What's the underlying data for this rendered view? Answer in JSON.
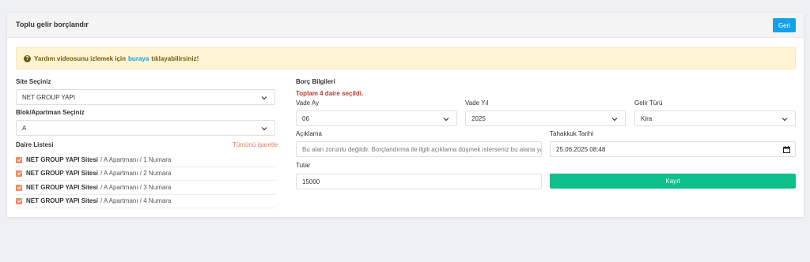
{
  "header": {
    "title": "Toplu gelir borçlandır",
    "back_label": "Geri"
  },
  "alert": {
    "prefix": "Yardım videosunu izlemek için",
    "link": "buraya",
    "suffix": "tıklayabilirsiniz!"
  },
  "left": {
    "site_label": "Site Seçiniz",
    "site_value": "NET GROUP YAPI",
    "block_label": "Blok/Apartman Seçiniz",
    "block_value": "A",
    "units_label": "Daire Listesi",
    "select_all": "Tümünü işaretle",
    "units": [
      {
        "site": "NET GROUP YAPI Sitesi",
        "path": "/ A Apartmanı / 1 Numara"
      },
      {
        "site": "NET GROUP YAPI Sitesi",
        "path": "/ A Apartmanı / 2 Numara"
      },
      {
        "site": "NET GROUP YAPI Sitesi",
        "path": "/ A Apartmanı / 3 Numara"
      },
      {
        "site": "NET GROUP YAPI Sitesi",
        "path": "/ A Apartmanı / 4 Numara"
      }
    ]
  },
  "right": {
    "section_title": "Borç Bilgileri",
    "selected_info": "Toplam 4 daire seçildi.",
    "vade_ay_label": "Vade Ay",
    "vade_ay_value": "06",
    "vade_yil_label": "Vade Yıl",
    "vade_yil_value": "2025",
    "gelir_turu_label": "Gelir Türü",
    "gelir_turu_value": "Kira",
    "aciklama_label": "Açıklama",
    "aciklama_placeholder": "Bu alan zorunlu değildir. Borçlandırma ile ilgili açıklama düşmek isterseniz bu alana yaza",
    "tahakkuk_label": "Tahakkuk Tarihi",
    "tahakkuk_value": "25.06.2025 08:48",
    "tutar_label": "Tutar",
    "tutar_value": "15000",
    "save_label": "Kayıt"
  }
}
